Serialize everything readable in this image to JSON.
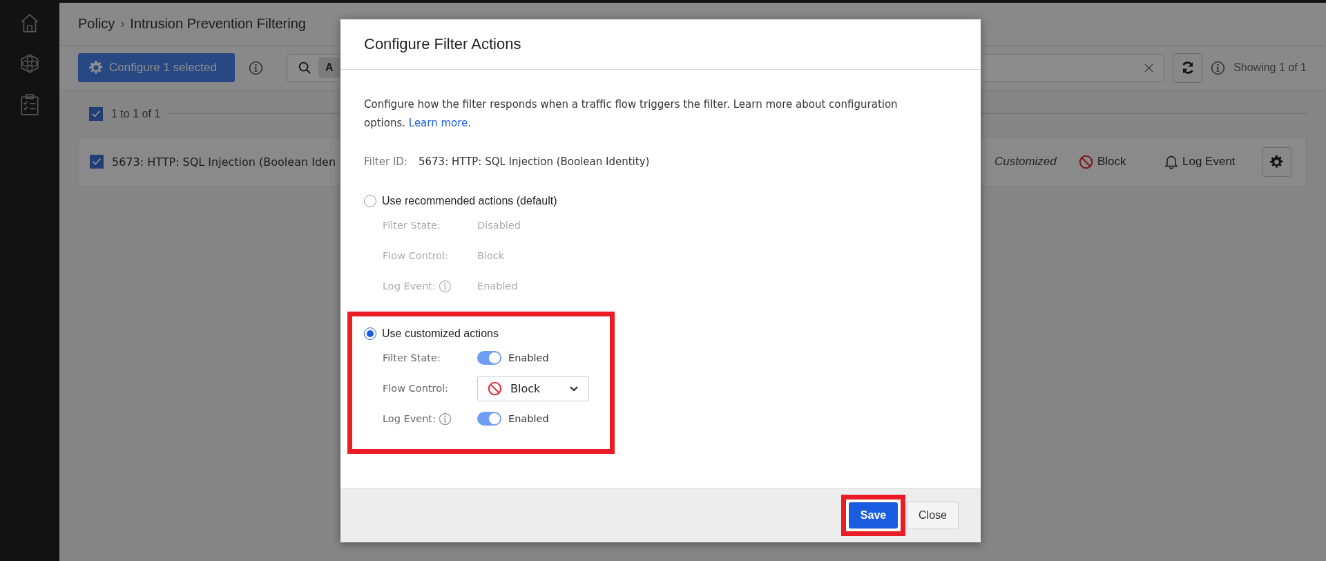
{
  "breadcrumb": {
    "items": [
      "Policy",
      "Intrusion Prevention Filtering"
    ],
    "separator": "›"
  },
  "toolbar": {
    "configure_button": "Configure 1 selected",
    "search": {
      "chip": "A"
    },
    "status": "Showing 1 of 1"
  },
  "list": {
    "select_all": {
      "checked": true,
      "label": "1 to 1 of 1"
    },
    "rows": [
      {
        "checked": true,
        "name": "5673: HTTP: SQL Injection (Boolean Iden",
        "mode": "Customized",
        "flow_control": "Block",
        "log": "Log Event"
      }
    ]
  },
  "dialog": {
    "title": "Configure Filter Actions",
    "description": "Configure how the filter responds when a traffic flow triggers the filter. Learn more about configuration options.",
    "link": "Learn more.",
    "filter_id": {
      "label": "Filter ID:",
      "value": "5673: HTTP: SQL Injection (Boolean Identity)"
    },
    "options": [
      {
        "label": "Use recommended actions (default)",
        "selected": false,
        "settings": [
          {
            "kind": "text",
            "label": "Filter State:",
            "value": "Disabled"
          },
          {
            "kind": "text",
            "label": "Flow Control:",
            "value": "Block"
          },
          {
            "kind": "text",
            "label": "Log Event:",
            "value": "Enabled",
            "info": true
          }
        ]
      },
      {
        "label": "Use customized actions",
        "selected": true,
        "highlighted": true,
        "settings": [
          {
            "kind": "toggle",
            "label": "Filter State:",
            "on": true,
            "value": "Enabled"
          },
          {
            "kind": "dropdown",
            "label": "Flow Control:",
            "value": "Block"
          },
          {
            "kind": "toggle",
            "label": "Log Event:",
            "on": true,
            "value": "Enabled",
            "info": true
          }
        ]
      }
    ],
    "buttons": [
      {
        "label": "Save",
        "kind": "primary",
        "highlighted": true
      },
      {
        "label": "Close",
        "kind": "secondary"
      }
    ]
  }
}
